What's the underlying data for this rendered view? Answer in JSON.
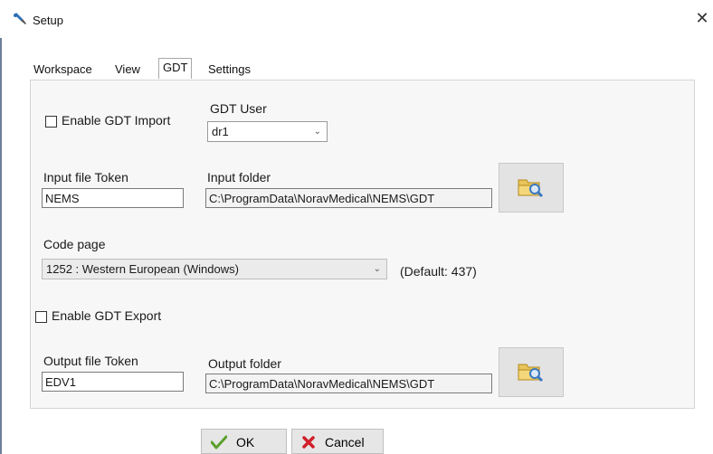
{
  "window": {
    "title": "Setup",
    "close_glyph": "✕",
    "icon": "setup-tool-icon"
  },
  "tabs": [
    {
      "label": "Workspace",
      "active": false
    },
    {
      "label": "View",
      "active": false
    },
    {
      "label": "GDT",
      "active": true
    },
    {
      "label": "Settings",
      "active": false
    }
  ],
  "gdt": {
    "enable_import_label": "Enable GDT Import",
    "enable_import_checked": false,
    "gdt_user_label": "GDT User",
    "gdt_user_value": "dr1",
    "input_token_label": "Input file Token",
    "input_token_value": "NEMS",
    "input_folder_label": "Input folder",
    "input_folder_value": "C:\\ProgramData\\NoravMedical\\NEMS\\GDT",
    "code_page_label": "Code page",
    "code_page_value": "1252 : Western European (Windows)",
    "code_page_default": "(Default: 437)",
    "enable_export_label": "Enable GDT Export",
    "enable_export_checked": false,
    "output_token_label": "Output file Token",
    "output_token_value": "EDV1",
    "output_folder_label": "Output folder",
    "output_folder_value": "C:\\ProgramData\\NoravMedical\\NEMS\\GDT",
    "browse_icon": "folder-search-icon"
  },
  "buttons": {
    "ok_label": "OK",
    "cancel_label": "Cancel"
  },
  "colors": {
    "ok_check": "#5aa02c",
    "cancel_x": "#d0202a",
    "folder": "#e9c45a",
    "magnifier": "#3a78c2"
  }
}
